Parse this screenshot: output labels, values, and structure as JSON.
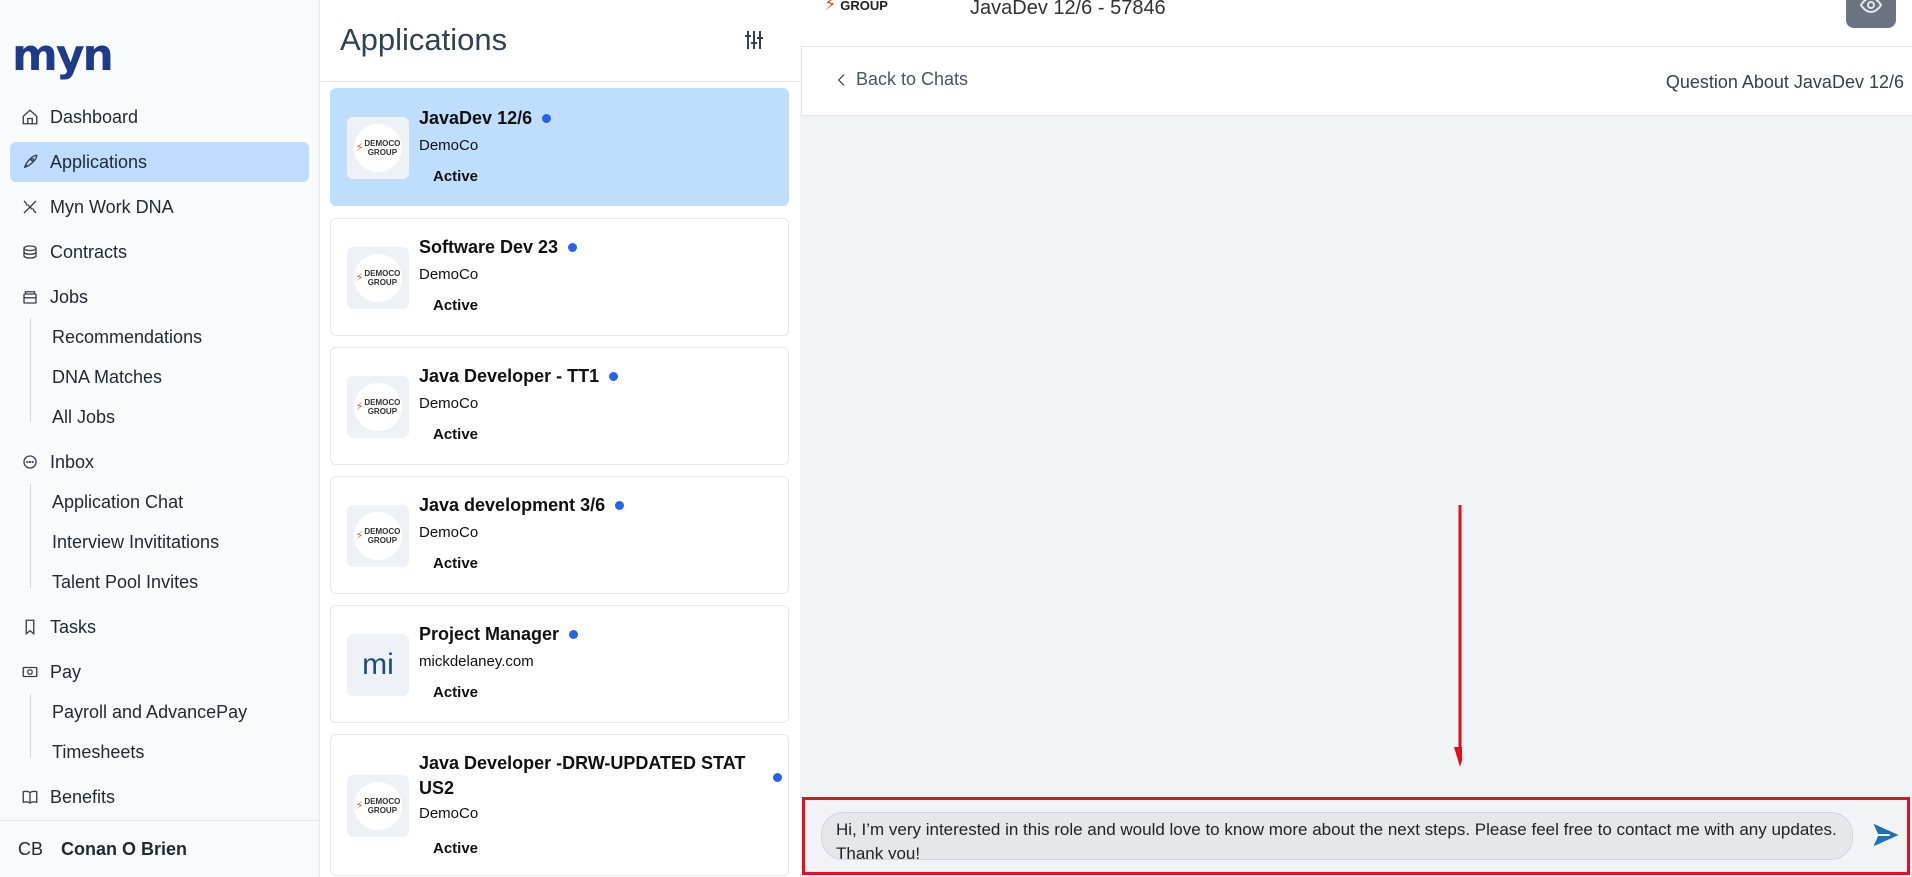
{
  "sidebar": {
    "logo": "myn",
    "nav": [
      {
        "label": "Dashboard",
        "icon": "home-icon"
      },
      {
        "label": "Applications",
        "icon": "rocket-icon",
        "active": true
      },
      {
        "label": "Myn Work DNA",
        "icon": "dna-icon"
      },
      {
        "label": "Contracts",
        "icon": "contracts-icon"
      },
      {
        "label": "Jobs",
        "icon": "jobs-icon"
      },
      {
        "label": "Inbox",
        "icon": "chat-bubble-icon"
      },
      {
        "label": "Tasks",
        "icon": "bookmark-icon"
      },
      {
        "label": "Pay",
        "icon": "money-icon"
      },
      {
        "label": "Benefits",
        "icon": "book-icon"
      }
    ],
    "jobs_sub": [
      "Recommendations",
      "DNA Matches",
      "All Jobs"
    ],
    "inbox_sub": [
      "Application Chat",
      "Interview Invititations",
      "Talent Pool Invites"
    ],
    "pay_sub": [
      "Payroll and AdvancePay",
      "Timesheets"
    ],
    "user": {
      "initials": "CB",
      "name": "Conan O Brien"
    }
  },
  "applications": {
    "title": "Applications",
    "cards": [
      {
        "title": "JavaDev 12/6",
        "company": "DemoCo",
        "status": "Active",
        "logo": "democo"
      },
      {
        "title": "Software Dev 23",
        "company": "DemoCo",
        "status": "Active",
        "logo": "democo"
      },
      {
        "title": "Java Developer - TT1",
        "company": "DemoCo",
        "status": "Active",
        "logo": "democo"
      },
      {
        "title": "Java development 3/6",
        "company": "DemoCo",
        "status": "Active",
        "logo": "democo"
      },
      {
        "title": "Project Manager",
        "company": "mickdelaney.com",
        "status": "Active",
        "logo": "mi"
      },
      {
        "title": "Java Developer -DRW-UPDATED STAT US2",
        "company": "DemoCo",
        "status": "Active",
        "logo": "democo"
      }
    ],
    "logo_text": {
      "line1": "DEMOCO",
      "line2": "GROUP",
      "mono": "mi"
    }
  },
  "chat": {
    "job_ref": "JavaDev 12/6 - 57846",
    "mini_logo": "GROUP",
    "back_label": "Back to Chats",
    "subject": "Question About JavaDev 12/6",
    "message": "Hi, I’m very interested in this role and would love to know more about the next steps. Please feel free to contact me with any updates. Thank you!"
  },
  "colors": {
    "accent": "#2563eb",
    "selected": "#bfdefe",
    "highlight": "#e0101c"
  }
}
